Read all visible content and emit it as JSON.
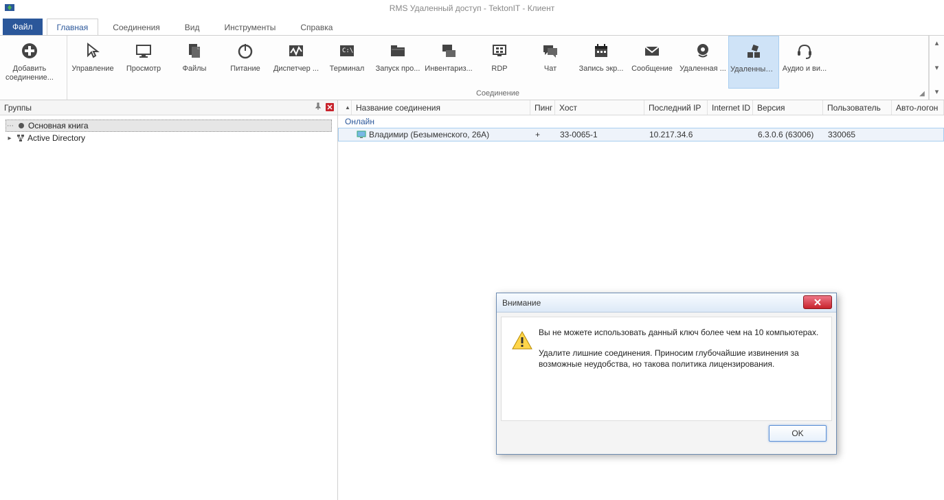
{
  "window": {
    "title": "RMS Удаленный доступ - TektonIT - Клиент"
  },
  "tabs": {
    "file": "Файл",
    "items": [
      "Главная",
      "Соединения",
      "Вид",
      "Инструменты",
      "Справка"
    ]
  },
  "ribbon": {
    "group_add": {
      "add": "Добавить\nсоединение..."
    },
    "group_conn": {
      "label": "Соединение",
      "buttons": [
        "Управление",
        "Просмотр",
        "Файлы",
        "Питание",
        "Диспетчер ...",
        "Терминал",
        "Запуск про...",
        "Инвентариз...",
        "RDP",
        "Чат",
        "Запись экр...",
        "Сообщение",
        "Удаленная ...",
        "Удаленный ...",
        "Аудио и ви..."
      ]
    }
  },
  "left": {
    "header": "Группы",
    "tree": [
      {
        "label": "Основная книга"
      },
      {
        "label": "Active Directory"
      }
    ]
  },
  "grid": {
    "columns": [
      "",
      "Название соединения",
      "Пинг",
      "Хост",
      "Последний IP",
      "Internet ID",
      "Версия",
      "Пользователь",
      "Авто-логон"
    ],
    "group": "Онлайн",
    "rows": [
      {
        "name": "Владимир (Безыменского, 26А)",
        "ping": "+",
        "host": "33-0065-1",
        "lastip": "10.217.34.6",
        "internet": "",
        "version": "6.3.0.6 (63006)",
        "user": "330065",
        "auto": ""
      }
    ]
  },
  "dialog": {
    "title": "Внимание",
    "line1": "Вы не можете использовать данный ключ более чем на 10 компьютерах.",
    "line2": "Удалите лишние соединения. Приносим глубочайшие извинения за возможные неудобства, но такова политика лицензирования.",
    "ok": "OK"
  }
}
